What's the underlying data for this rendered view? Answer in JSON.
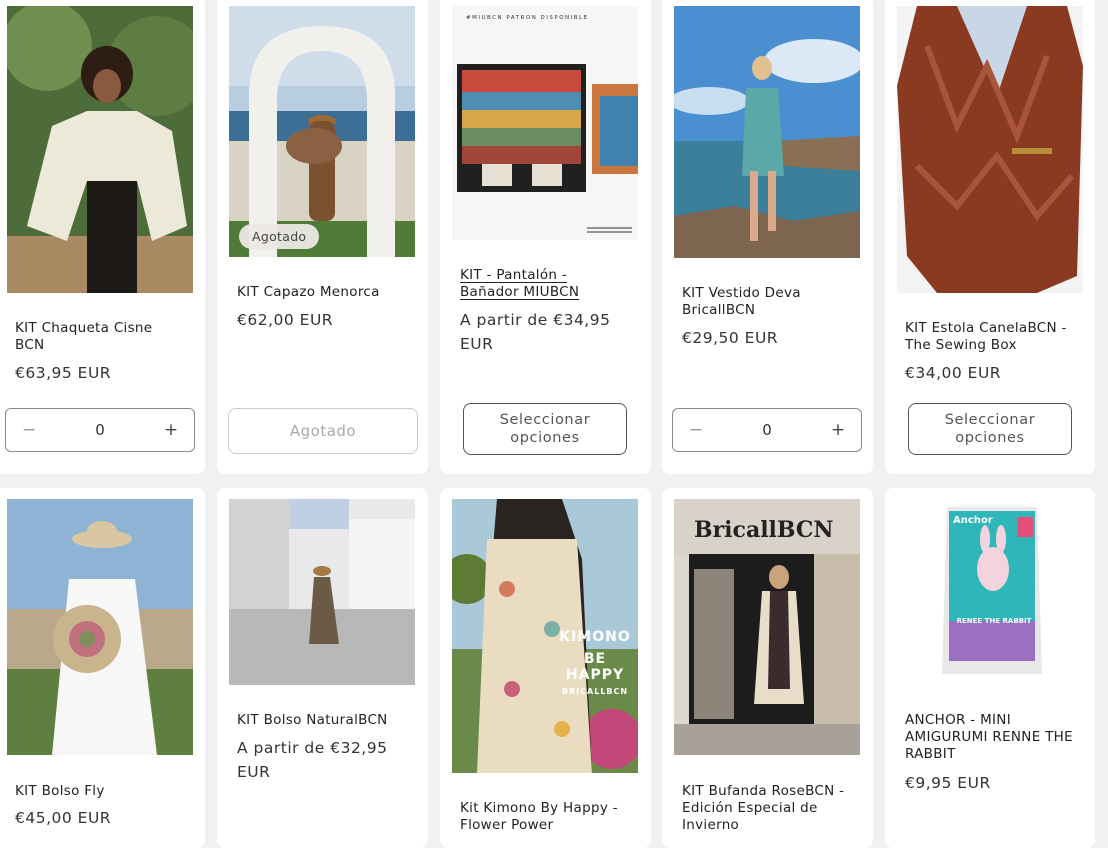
{
  "products": [
    {
      "title": "KIT Chaqueta Cisne BCN",
      "price": "€63,95 EUR",
      "quantity": "0",
      "minus": "−",
      "plus": "+"
    },
    {
      "title": "KIT Capazo Menorca",
      "price": "€62,00 EUR",
      "badge": "Agotado",
      "button": "Agotado"
    },
    {
      "title": "KIT - Pantalón - Bañador MIUBCN",
      "price": "A partir de €34,95 EUR",
      "button": "Seleccionar opciones",
      "image_text": "#MIUBCN PATRON DISPONIBLE"
    },
    {
      "title": "KIT Vestido Deva BricallBCN",
      "price": "€29,50 EUR",
      "quantity": "0",
      "minus": "−",
      "plus": "+"
    },
    {
      "title": "KIT Estola CanelaBCN - The Sewing Box",
      "price": "€34,00 EUR",
      "button": "Seleccionar opciones"
    },
    {
      "title": "KIT Bolso Fly",
      "price": "€45,00 EUR"
    },
    {
      "title": "KIT Bolso NaturalBCN",
      "price": "A partir de €32,95 EUR"
    },
    {
      "title": "Kit Kimono By Happy - Flower Power",
      "image_text_1": "KIMONO",
      "image_text_2": "BE HAPPY",
      "image_text_3": "BRICALLBCN"
    },
    {
      "title": "KIT Bufanda RoseBCN - Edición Especial de Invierno",
      "image_text": "BricallBCN"
    },
    {
      "title": "ANCHOR - MINI AMIGURUMI RENNE THE RABBIT",
      "price": "€9,95 EUR",
      "image_brand": "Anchor",
      "image_label": "RENEE THE RABBIT"
    }
  ],
  "colors": {
    "page_bg": "#f1f1f1",
    "card_bg": "#ffffff",
    "border_dark": "#555555",
    "border_light": "#c9c9c9"
  }
}
